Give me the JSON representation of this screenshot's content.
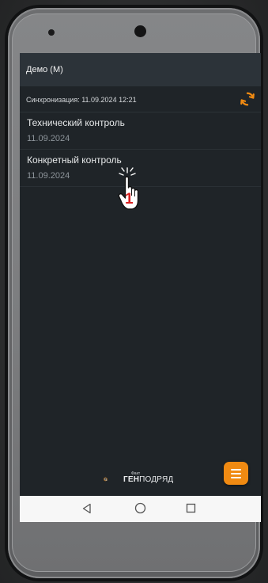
{
  "app": {
    "title": "Демо (М)"
  },
  "sync": {
    "label": "Синхронизация: 11.09.2024 12:21",
    "icon": "sync-icon",
    "icon_color": "#f08a12"
  },
  "items": [
    {
      "title": "Технический контроль",
      "date": "11.09.2024"
    },
    {
      "title": "Конкретный контроль",
      "date": "11.09.2024"
    }
  ],
  "annotation": {
    "step": "1",
    "cursor_icon": "hand-pointer-icon",
    "step_color": "#d81f1f"
  },
  "brand": {
    "prefix": "Факт",
    "name_bold": "ГЕН",
    "name_rest": "ПОДРЯД"
  },
  "fab": {
    "icon": "menu-icon",
    "color": "#f08a12"
  },
  "nav": {
    "back_icon": "back-triangle-icon",
    "home_icon": "home-circle-icon",
    "recent_icon": "recent-square-icon"
  }
}
